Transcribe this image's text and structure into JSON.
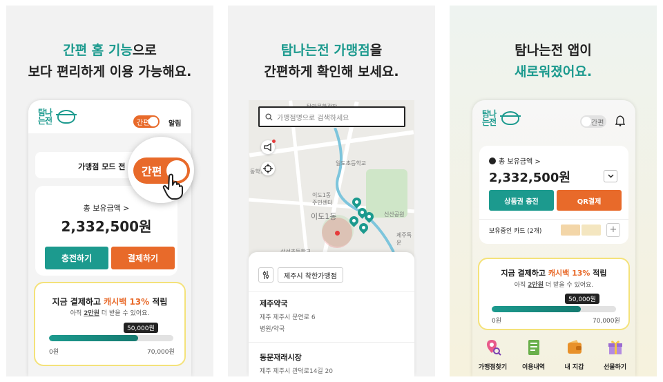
{
  "panel1": {
    "headline_hl": "간편 홈 기능",
    "headline_rest": "으로",
    "headline_line2": "보다 편리하게 이용 가능해요.",
    "logo": "탐나는전",
    "toggle_label": "간편",
    "alarm_label": "알림",
    "merchant_mode": "가맹점 모드 전",
    "zoom_toggle_label": "간편",
    "balance_label": "총 보유금액 >",
    "balance": "2,332,500원",
    "charge_button": "충전하기",
    "pay_button": "결제하기",
    "promo_pre": "지금 결제하고 ",
    "promo_hl": "캐시백 13%",
    "promo_post": " 적립",
    "promo_sub_pre": "아직 ",
    "promo_sub_hl": "2만원",
    "promo_sub_post": " 더 받을 수 있어요.",
    "progress_tip": "50,000원",
    "progress_fraction": 0.714,
    "progress_min": "0원",
    "progress_max": "70,000원"
  },
  "panel2": {
    "headline_hl": "탐나는전 가맹점",
    "headline_rest": "을",
    "headline_line2": "간편하게 확인해 보세요.",
    "search_placeholder": "가맹점명으로 검색하세요",
    "map_labels": {
      "top": "탐라문화광장",
      "school1": "일도초등학교",
      "school2": "동학교",
      "center": "이도1동\n주민센터",
      "district": "이도1동",
      "park": "신산공원",
      "jeju": "제주특\n운",
      "school3": "삼성초등학교"
    },
    "filter_chip": "제주시 착한가맹점",
    "results": [
      {
        "name": "제주약국",
        "address": "제주 제주시 문연로 6",
        "category": "병원/약국"
      },
      {
        "name": "동문재래시장",
        "address": "제주 제주시 관덕로14길 20",
        "category": ""
      }
    ]
  },
  "panel3": {
    "headline_line1": "탐나는전 앱이",
    "headline_hl": "새로워졌어요.",
    "logo": "탐나는전",
    "toggle_label": "간편",
    "balance_label": "총 보유금액 >",
    "balance": "2,332,500원",
    "voucher_button": "상품권 충전",
    "qr_button": "QR결제",
    "cards_label": "보유중인 카드 (2개)",
    "promo_pre": "지금 결제하고 ",
    "promo_hl": "캐시백 13%",
    "promo_post": " 적립",
    "promo_sub_pre": "아직 ",
    "promo_sub_hl": "2만원",
    "promo_sub_post": " 더 받을 수 있어요.",
    "progress_tip": "50,000원",
    "progress_fraction": 0.714,
    "progress_min": "0원",
    "progress_max": "70,000원",
    "menu": [
      {
        "label": "가맹점찾기",
        "icon": "map-search-icon"
      },
      {
        "label": "이용내역",
        "icon": "ledger-icon"
      },
      {
        "label": "내 지갑",
        "icon": "wallet-icon"
      },
      {
        "label": "선물하기",
        "icon": "gift-icon"
      }
    ]
  },
  "colors": {
    "teal": "#1c9a8e",
    "orange": "#e86a2a",
    "promo_border": "#f4e27a"
  }
}
